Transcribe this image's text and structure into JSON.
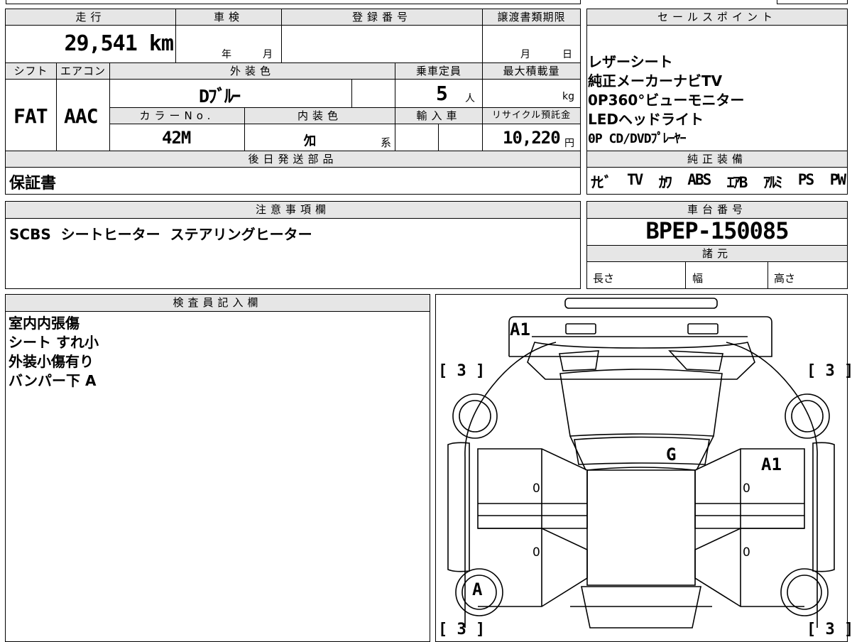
{
  "basic": {
    "mileage_header": "走行",
    "mileage_value": "29,541 km",
    "inspection_header": "車検",
    "inspection_year": "年",
    "inspection_month": "月",
    "registration_header": "登録番号",
    "transfer_header": "譲渡書類期限",
    "transfer_month": "月",
    "transfer_day": "日",
    "shift_header": "シフト",
    "shift_value": "FAT",
    "aircon_header": "エアコン",
    "aircon_value": "AAC",
    "exterior_header": "外装色",
    "exterior_value": "Dﾌﾞﾙｰ",
    "capacity_header": "乗車定員",
    "capacity_value": "5",
    "capacity_unit": "人",
    "maxload_header": "最大積載量",
    "maxload_unit": "kg",
    "color_no_header": "カラーNo.",
    "color_no_value": "42M",
    "interior_header": "内装色",
    "interior_value": "ｸﾛ",
    "interior_unit": "系",
    "import_header": "輸入車",
    "recycle_header": "リサイクル預託金",
    "recycle_value": "10,220",
    "recycle_unit": "円",
    "later_header": "後日発送部品",
    "later_value": "保証書"
  },
  "sales": {
    "header": "セールスポイント",
    "lines": [
      "レザーシート",
      "純正メーカーナビTV",
      "0P360°ビューモニター",
      "LEDヘッドライト",
      "0P CD/DVDﾌﾟﾚｰﾔｰ"
    ]
  },
  "equipment": {
    "header": "純正装備",
    "items": [
      "ﾅﾋﾞ",
      "TV",
      "ｶﾜ",
      "ABS",
      "ｴｱB",
      "ｱﾙﾐ",
      "PS",
      "PW"
    ]
  },
  "notes": {
    "header": "注意事項欄",
    "value": "SCBS  シートヒーター  ステアリングヒーター"
  },
  "chassis": {
    "header": "車台番号",
    "value": "BPEP-150085",
    "spec_header": "諸元",
    "length_label": "長さ",
    "width_label": "幅",
    "height_label": "高さ"
  },
  "inspector": {
    "header": "検査員記入欄",
    "lines": [
      "室内内張傷",
      "シート すれ小",
      "外装小傷有り",
      "バンパー下 A"
    ]
  },
  "diagram": {
    "mark_front": "A1",
    "mark_windshield": "G",
    "mark_right_door": "A1",
    "mark_left_wheel": "A",
    "tire_fl": "[ 3 ]",
    "tire_fr": "[ 3 ]",
    "tire_rl": "[ 3 ]",
    "tire_rr": "[ 3 ]",
    "zero1": "0",
    "zero2": "0",
    "zero3": "0",
    "zero4": "0"
  }
}
